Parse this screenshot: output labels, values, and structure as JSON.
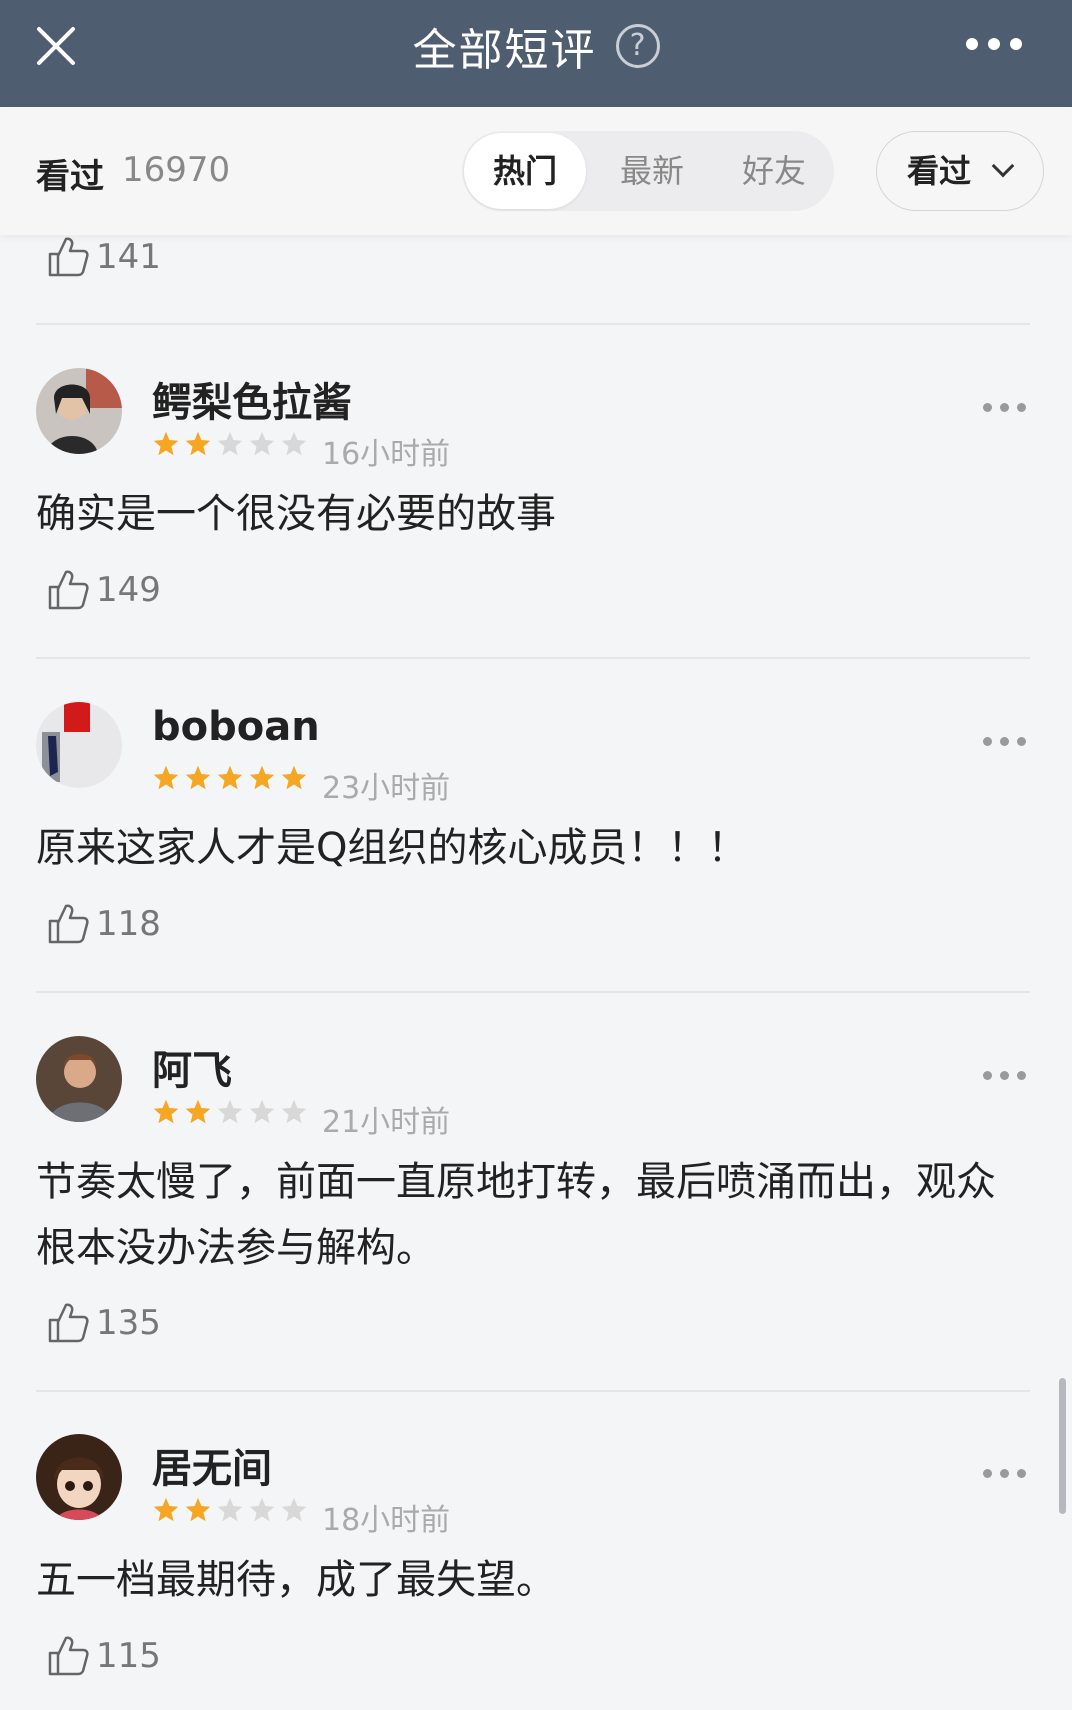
{
  "header": {
    "title": "全部短评",
    "help_glyph": "?"
  },
  "filter": {
    "seen_label": "看过",
    "seen_count": "16970",
    "tabs": [
      {
        "label": "热门",
        "selected": true
      },
      {
        "label": "最新",
        "selected": false
      },
      {
        "label": "好友",
        "selected": false
      }
    ],
    "status_dropdown": "看过"
  },
  "partial_like_count": "141",
  "reviews": [
    {
      "username": "鳄梨色拉酱",
      "rating": 2,
      "time": "16小时前",
      "content": "确实是一个很没有必要的故事",
      "likes": "149"
    },
    {
      "username": "boboan",
      "rating": 5,
      "time": "23小时前",
      "content": "原来这家人才是Q组织的核心成员！！！",
      "likes": "118"
    },
    {
      "username": "阿飞",
      "rating": 2,
      "time": "21小时前",
      "content": "节奏太慢了，前面一直原地打转，最后喷涌而出，观众根本没办法参与解构。",
      "likes": "135"
    },
    {
      "username": "居无间",
      "rating": 2,
      "time": "18小时前",
      "content": "五一档最期待，成了最失望。",
      "likes": "115"
    }
  ],
  "colors": {
    "header_bg": "#4f5d70",
    "star_on": "#f5a623",
    "star_off": "#d8d8d8",
    "page_bg": "#f4f5f7"
  }
}
